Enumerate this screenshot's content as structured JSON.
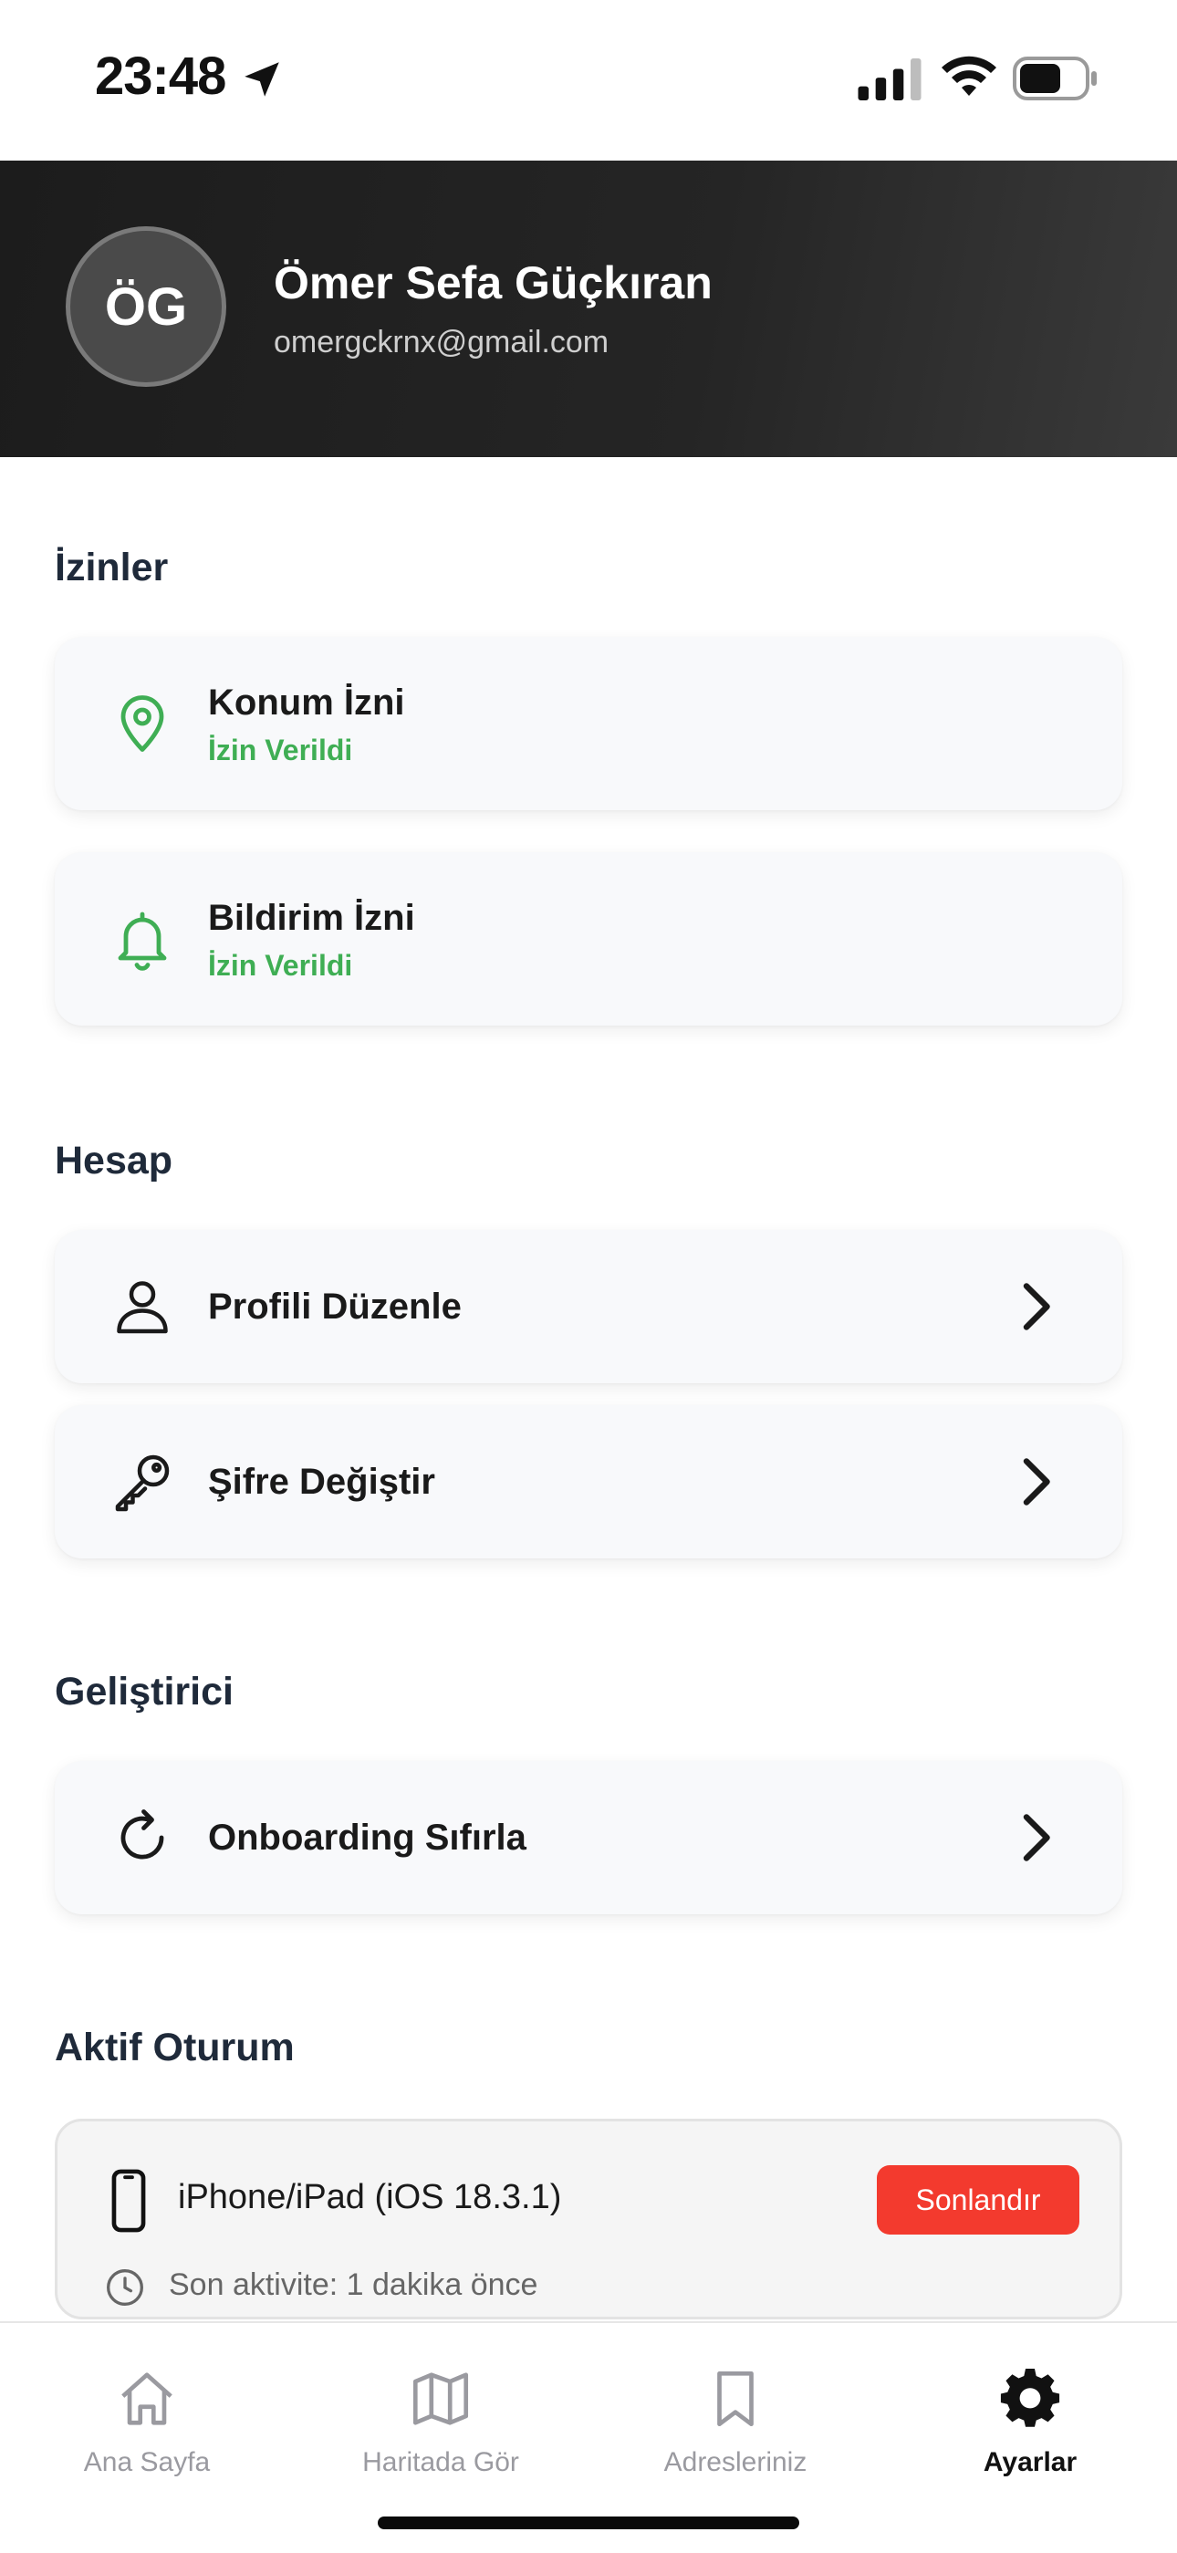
{
  "status_bar": {
    "time": "23:48"
  },
  "profile": {
    "initials": "ÖG",
    "name": "Ömer Sefa Güçkıran",
    "email": "omergckrnx@gmail.com"
  },
  "sections": {
    "permissions": {
      "title": "İzinler",
      "items": [
        {
          "title": "Konum İzni",
          "status": "İzin Verildi",
          "icon": "location-pin-icon"
        },
        {
          "title": "Bildirim İzni",
          "status": "İzin Verildi",
          "icon": "bell-icon"
        }
      ]
    },
    "account": {
      "title": "Hesap",
      "items": [
        {
          "title": "Profili Düzenle",
          "icon": "user-icon"
        },
        {
          "title": "Şifre Değiştir",
          "icon": "key-icon"
        }
      ]
    },
    "developer": {
      "title": "Geliştirici",
      "items": [
        {
          "title": "Onboarding Sıfırla",
          "icon": "refresh-icon"
        }
      ]
    },
    "session": {
      "title": "Aktif Oturum",
      "device": "iPhone/iPad (iOS 18.3.1)",
      "end_label": "Sonlandır",
      "activity": "Son aktivite: 1 dakika önce"
    }
  },
  "tab_bar": {
    "tabs": [
      {
        "label": "Ana Sayfa",
        "icon": "home-icon",
        "active": false
      },
      {
        "label": "Haritada Gör",
        "icon": "map-icon",
        "active": false
      },
      {
        "label": "Adresleriniz",
        "icon": "bookmark-icon",
        "active": false
      },
      {
        "label": "Ayarlar",
        "icon": "gear-icon",
        "active": true
      }
    ]
  },
  "colors": {
    "accent_green": "#3fae54",
    "danger_red": "#f33a2e",
    "header_dark": "#1c1c1c"
  }
}
